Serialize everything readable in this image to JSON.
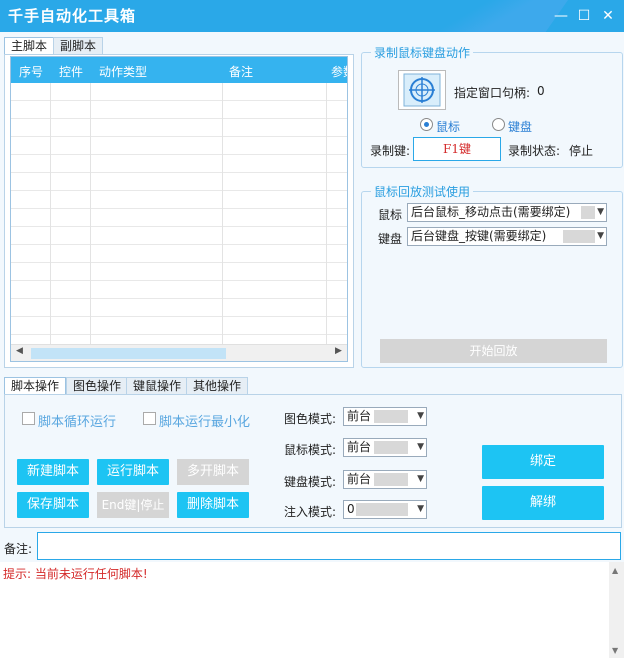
{
  "window": {
    "title": "千手自动化工具箱",
    "controls": {
      "minimize": "—",
      "maximize": "☐",
      "close": "✕"
    }
  },
  "script_tabs": [
    "主脚本",
    "副脚本"
  ],
  "table": {
    "columns": [
      "序号",
      "控件",
      "动作类型",
      "备注",
      "参数"
    ],
    "rows": []
  },
  "record_group": {
    "legend": "录制鼠标键盘动作",
    "window_handle_label": "指定窗口句柄:",
    "window_handle_value": "0",
    "radio_mouse": "鼠标",
    "radio_keyboard": "键盘",
    "record_key_label": "录制键:",
    "record_key_value": "F1键",
    "record_status_label": "录制状态:",
    "record_status_value": "停止"
  },
  "playback_group": {
    "legend": "鼠标回放测试使用",
    "mouse_label": "鼠标",
    "mouse_value": "后台鼠标_移动点击(需要绑定)",
    "keyboard_label": "键盘",
    "keyboard_value": "后台键盘_按键(需要绑定)",
    "start_button": "开始回放"
  },
  "op_tabs": [
    "脚本操作",
    "图色操作",
    "键鼠操作",
    "其他操作"
  ],
  "script_ops": {
    "loop_checkbox": "脚本循环运行",
    "minimize_checkbox": "脚本运行最小化",
    "new_button": "新建脚本",
    "run_button": "运行脚本",
    "multi_button": "多开脚本",
    "save_button": "保存脚本",
    "end_button": "End键|停止",
    "delete_button": "删除脚本"
  },
  "modes": {
    "color_mode_label": "图色模式:",
    "color_mode_value": "前台",
    "mouse_mode_label": "鼠标模式:",
    "mouse_mode_value": "前台",
    "keyboard_mode_label": "键盘模式:",
    "keyboard_mode_value": "前台",
    "inject_mode_label": "注入模式:",
    "inject_mode_value": "0"
  },
  "bind_button": "绑定",
  "unbind_button": "解绑",
  "remark": {
    "label": "备注:",
    "value": ""
  },
  "log": {
    "message": "提示: 当前未运行任何脚本!"
  },
  "colors": {
    "accent": "#1dc4f3",
    "title_bar": "#2aa8e8",
    "legend": "#2a9ee0",
    "error_text": "#d42a2a"
  }
}
